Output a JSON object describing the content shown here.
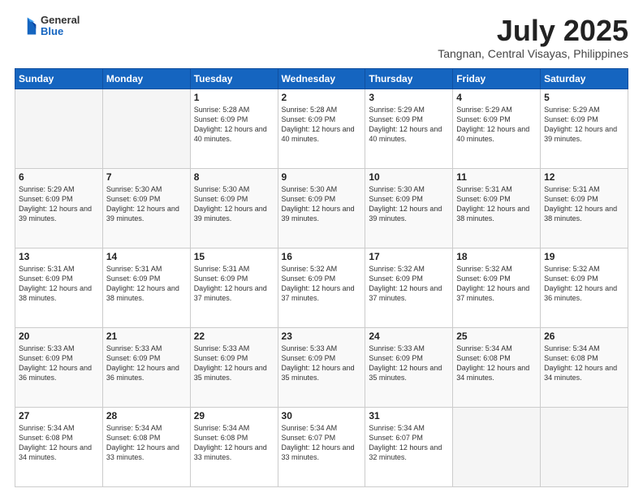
{
  "header": {
    "logo_general": "General",
    "logo_blue": "Blue",
    "month_title": "July 2025",
    "location": "Tangnan, Central Visayas, Philippines"
  },
  "days_of_week": [
    "Sunday",
    "Monday",
    "Tuesday",
    "Wednesday",
    "Thursday",
    "Friday",
    "Saturday"
  ],
  "weeks": [
    [
      {
        "num": "",
        "info": ""
      },
      {
        "num": "",
        "info": ""
      },
      {
        "num": "1",
        "info": "Sunrise: 5:28 AM\nSunset: 6:09 PM\nDaylight: 12 hours and 40 minutes."
      },
      {
        "num": "2",
        "info": "Sunrise: 5:28 AM\nSunset: 6:09 PM\nDaylight: 12 hours and 40 minutes."
      },
      {
        "num": "3",
        "info": "Sunrise: 5:29 AM\nSunset: 6:09 PM\nDaylight: 12 hours and 40 minutes."
      },
      {
        "num": "4",
        "info": "Sunrise: 5:29 AM\nSunset: 6:09 PM\nDaylight: 12 hours and 40 minutes."
      },
      {
        "num": "5",
        "info": "Sunrise: 5:29 AM\nSunset: 6:09 PM\nDaylight: 12 hours and 39 minutes."
      }
    ],
    [
      {
        "num": "6",
        "info": "Sunrise: 5:29 AM\nSunset: 6:09 PM\nDaylight: 12 hours and 39 minutes."
      },
      {
        "num": "7",
        "info": "Sunrise: 5:30 AM\nSunset: 6:09 PM\nDaylight: 12 hours and 39 minutes."
      },
      {
        "num": "8",
        "info": "Sunrise: 5:30 AM\nSunset: 6:09 PM\nDaylight: 12 hours and 39 minutes."
      },
      {
        "num": "9",
        "info": "Sunrise: 5:30 AM\nSunset: 6:09 PM\nDaylight: 12 hours and 39 minutes."
      },
      {
        "num": "10",
        "info": "Sunrise: 5:30 AM\nSunset: 6:09 PM\nDaylight: 12 hours and 39 minutes."
      },
      {
        "num": "11",
        "info": "Sunrise: 5:31 AM\nSunset: 6:09 PM\nDaylight: 12 hours and 38 minutes."
      },
      {
        "num": "12",
        "info": "Sunrise: 5:31 AM\nSunset: 6:09 PM\nDaylight: 12 hours and 38 minutes."
      }
    ],
    [
      {
        "num": "13",
        "info": "Sunrise: 5:31 AM\nSunset: 6:09 PM\nDaylight: 12 hours and 38 minutes."
      },
      {
        "num": "14",
        "info": "Sunrise: 5:31 AM\nSunset: 6:09 PM\nDaylight: 12 hours and 38 minutes."
      },
      {
        "num": "15",
        "info": "Sunrise: 5:31 AM\nSunset: 6:09 PM\nDaylight: 12 hours and 37 minutes."
      },
      {
        "num": "16",
        "info": "Sunrise: 5:32 AM\nSunset: 6:09 PM\nDaylight: 12 hours and 37 minutes."
      },
      {
        "num": "17",
        "info": "Sunrise: 5:32 AM\nSunset: 6:09 PM\nDaylight: 12 hours and 37 minutes."
      },
      {
        "num": "18",
        "info": "Sunrise: 5:32 AM\nSunset: 6:09 PM\nDaylight: 12 hours and 37 minutes."
      },
      {
        "num": "19",
        "info": "Sunrise: 5:32 AM\nSunset: 6:09 PM\nDaylight: 12 hours and 36 minutes."
      }
    ],
    [
      {
        "num": "20",
        "info": "Sunrise: 5:33 AM\nSunset: 6:09 PM\nDaylight: 12 hours and 36 minutes."
      },
      {
        "num": "21",
        "info": "Sunrise: 5:33 AM\nSunset: 6:09 PM\nDaylight: 12 hours and 36 minutes."
      },
      {
        "num": "22",
        "info": "Sunrise: 5:33 AM\nSunset: 6:09 PM\nDaylight: 12 hours and 35 minutes."
      },
      {
        "num": "23",
        "info": "Sunrise: 5:33 AM\nSunset: 6:09 PM\nDaylight: 12 hours and 35 minutes."
      },
      {
        "num": "24",
        "info": "Sunrise: 5:33 AM\nSunset: 6:09 PM\nDaylight: 12 hours and 35 minutes."
      },
      {
        "num": "25",
        "info": "Sunrise: 5:34 AM\nSunset: 6:08 PM\nDaylight: 12 hours and 34 minutes."
      },
      {
        "num": "26",
        "info": "Sunrise: 5:34 AM\nSunset: 6:08 PM\nDaylight: 12 hours and 34 minutes."
      }
    ],
    [
      {
        "num": "27",
        "info": "Sunrise: 5:34 AM\nSunset: 6:08 PM\nDaylight: 12 hours and 34 minutes."
      },
      {
        "num": "28",
        "info": "Sunrise: 5:34 AM\nSunset: 6:08 PM\nDaylight: 12 hours and 33 minutes."
      },
      {
        "num": "29",
        "info": "Sunrise: 5:34 AM\nSunset: 6:08 PM\nDaylight: 12 hours and 33 minutes."
      },
      {
        "num": "30",
        "info": "Sunrise: 5:34 AM\nSunset: 6:07 PM\nDaylight: 12 hours and 33 minutes."
      },
      {
        "num": "31",
        "info": "Sunrise: 5:34 AM\nSunset: 6:07 PM\nDaylight: 12 hours and 32 minutes."
      },
      {
        "num": "",
        "info": ""
      },
      {
        "num": "",
        "info": ""
      }
    ]
  ]
}
